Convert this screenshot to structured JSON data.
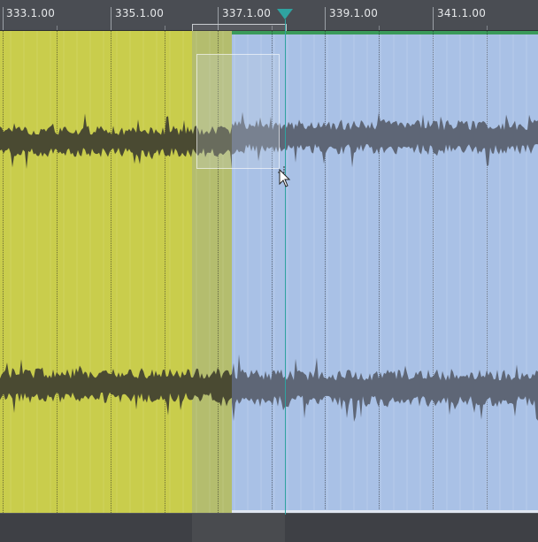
{
  "ruler": {
    "markers": [
      {
        "label": "333.1.00"
      },
      {
        "label": "335.1.00"
      },
      {
        "label": "337.1.00"
      },
      {
        "label": "339.1.00"
      },
      {
        "label": "341.1.00"
      }
    ]
  },
  "regions": {
    "left": {
      "color": "#c9cd4c"
    },
    "right": {
      "color": "#a9c1e6"
    },
    "waveform_dark": "#4a4a32",
    "waveform_blue": "#5e6676"
  },
  "playhead": {
    "color": "#2fa3a0"
  }
}
